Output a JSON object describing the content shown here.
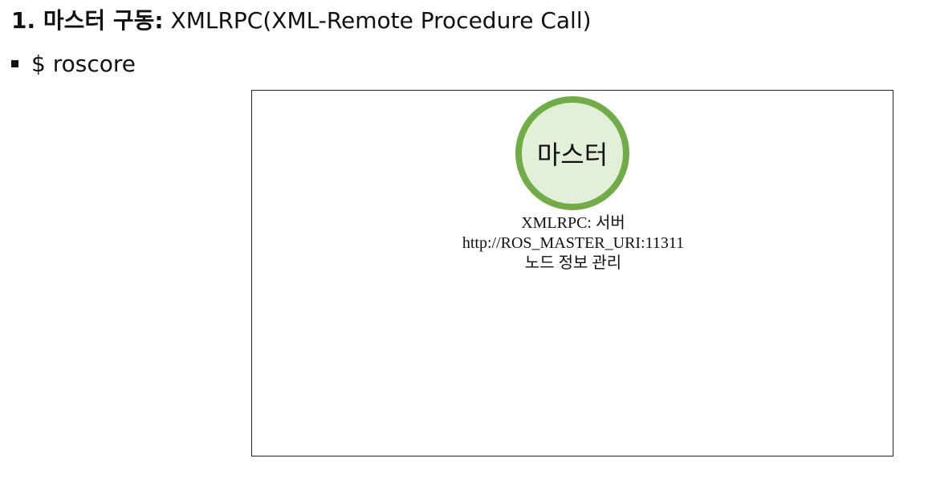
{
  "heading": {
    "number_label": "1. 마스터 구동:",
    "description": " XMLRPC(XML-Remote Procedure Call)"
  },
  "bullet": {
    "text": "$ roscore"
  },
  "diagram": {
    "master_node": {
      "label": "마스터",
      "fill_color": "#e2efd9",
      "border_color": "#70ad47"
    },
    "info_lines": [
      "XMLRPC: 서버",
      "http://ROS_MASTER_URI:11311",
      "노드 정보 관리"
    ]
  }
}
